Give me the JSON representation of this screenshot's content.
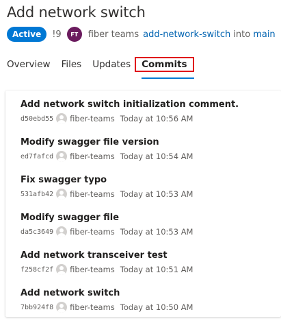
{
  "pull_request": {
    "title": "Add network switch",
    "status": "Active",
    "id": "!9",
    "author_initials": "FT",
    "author_name": "fiber teams",
    "source_branch": "add-network-switch",
    "into_label": "into",
    "target_branch": "main"
  },
  "tabs": [
    {
      "label": "Overview"
    },
    {
      "label": "Files"
    },
    {
      "label": "Updates"
    },
    {
      "label": "Commits",
      "selected": true
    }
  ],
  "commits": [
    {
      "message": "Add network switch initialization comment.",
      "hash": "d50ebd55",
      "author": "fiber-teams",
      "time": "Today at 10:56 AM"
    },
    {
      "message": "Modify swagger file version",
      "hash": "ed7fafcd",
      "author": "fiber-teams",
      "time": "Today at 10:54 AM"
    },
    {
      "message": "Fix swagger typo",
      "hash": "531afb42",
      "author": "fiber-teams",
      "time": "Today at 10:53 AM"
    },
    {
      "message": "Modify swagger file",
      "hash": "da5c3649",
      "author": "fiber-teams",
      "time": "Today at 10:53 AM"
    },
    {
      "message": "Add network transceiver test",
      "hash": "f258cf2f",
      "author": "fiber-teams",
      "time": "Today at 10:51 AM"
    },
    {
      "message": "Add network switch",
      "hash": "7bb924f8",
      "author": "fiber-teams",
      "time": "Today at 10:50 AM"
    }
  ],
  "colors": {
    "accent": "#0078d4",
    "link": "#0063b1",
    "avatar": "#6b1b5e",
    "highlight_box": "#e0101b"
  }
}
